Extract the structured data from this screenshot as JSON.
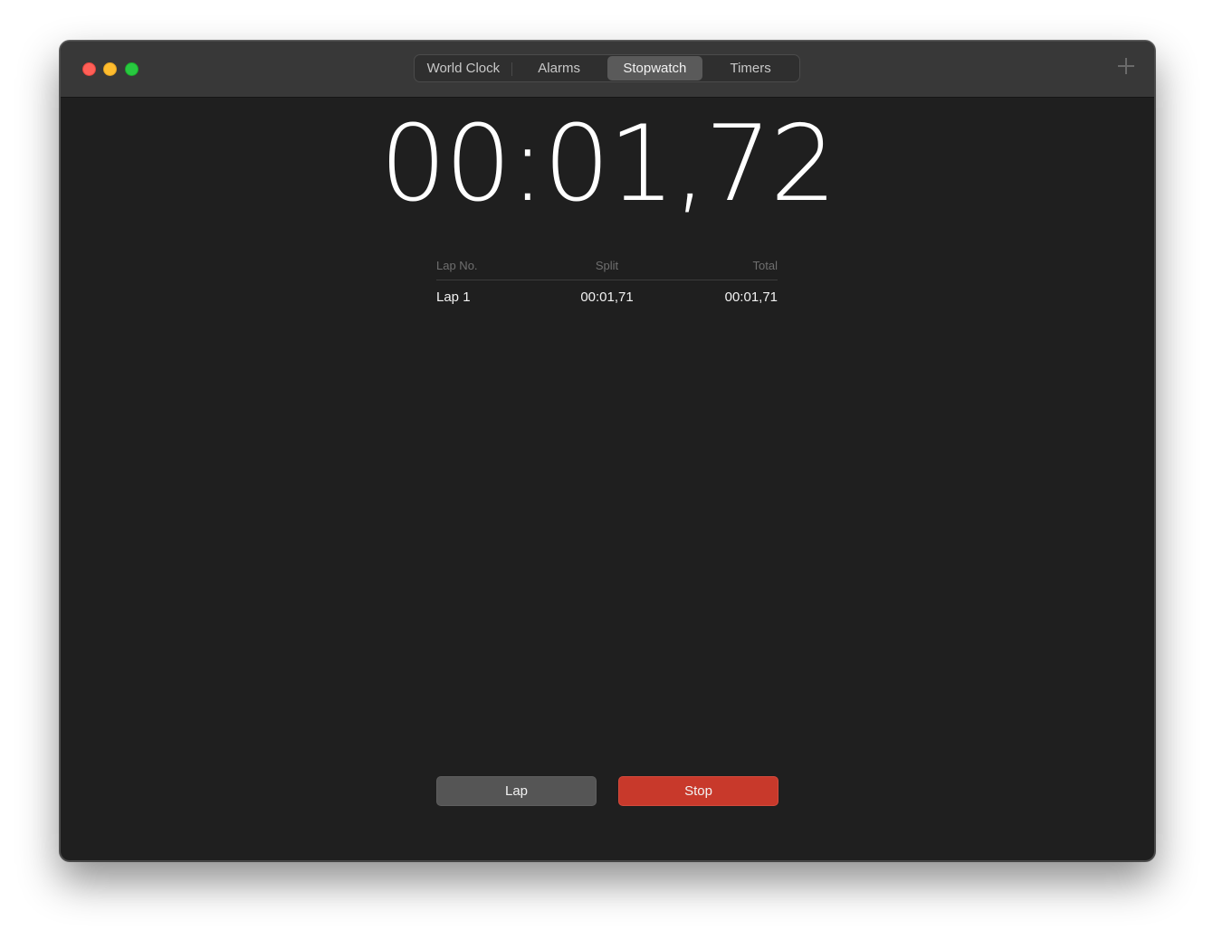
{
  "window": {
    "tabs": [
      {
        "label": "World Clock",
        "active": false
      },
      {
        "label": "Alarms",
        "active": false
      },
      {
        "label": "Stopwatch",
        "active": true
      },
      {
        "label": "Timers",
        "active": false
      }
    ],
    "add_icon": "plus-icon"
  },
  "stopwatch": {
    "elapsed": "00:01,72",
    "laps_header": {
      "lap_no": "Lap No.",
      "split": "Split",
      "total": "Total"
    },
    "laps": [
      {
        "lap": "Lap 1",
        "split": "00:01,71",
        "total": "00:01,71"
      }
    ]
  },
  "controls": {
    "lap_label": "Lap",
    "stop_label": "Stop",
    "stop_color": "#c8392b",
    "lap_color": "#555555"
  }
}
